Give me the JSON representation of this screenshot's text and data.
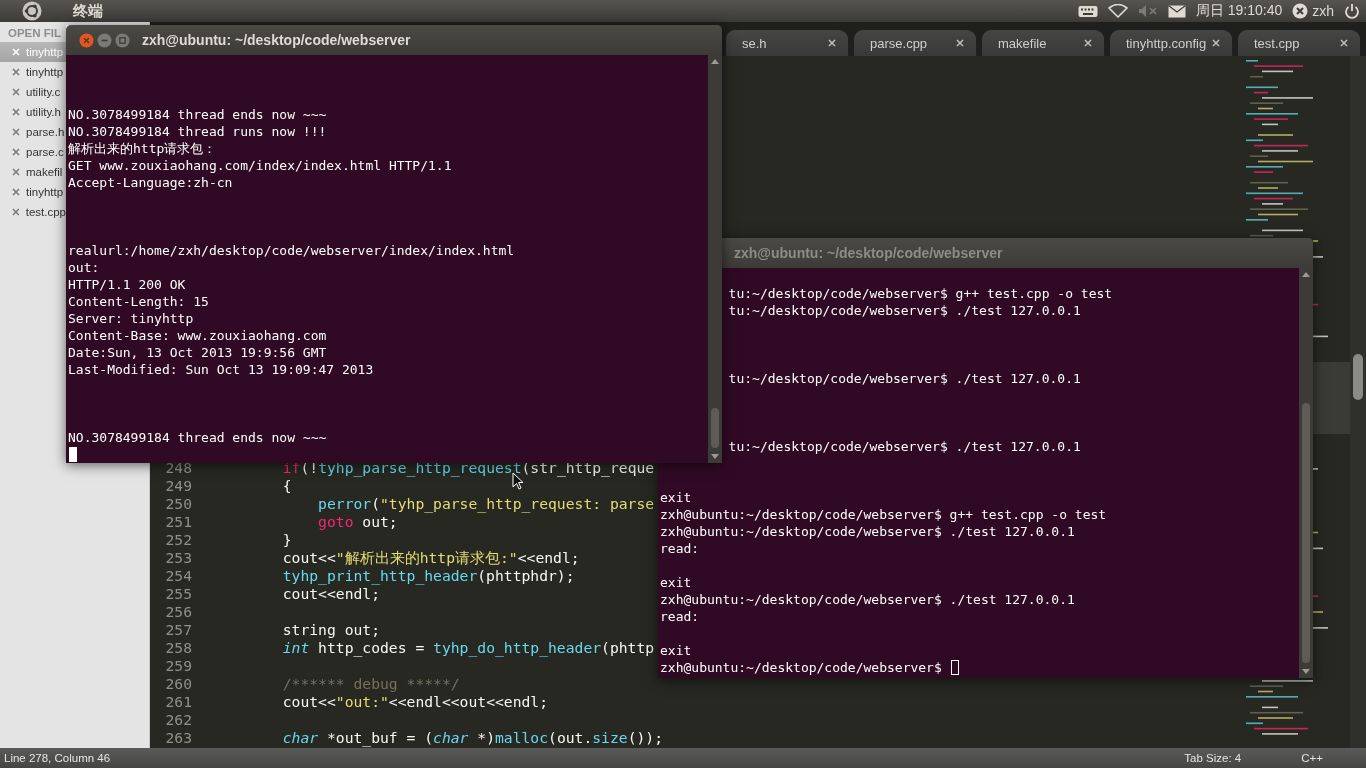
{
  "top_panel": {
    "app_title": "终端",
    "clock": "周日 19:10:40",
    "user": "zxh"
  },
  "sidebar": {
    "header": "OPEN FIL",
    "items": [
      {
        "label": "tinyhttp",
        "selected": true
      },
      {
        "label": "tinyhttp",
        "selected": false
      },
      {
        "label": "utility.c",
        "selected": false
      },
      {
        "label": "utility.h",
        "selected": false
      },
      {
        "label": "parse.h",
        "selected": false
      },
      {
        "label": "parse.c",
        "selected": false
      },
      {
        "label": "makefil",
        "selected": false
      },
      {
        "label": "tinyhttp",
        "selected": false
      },
      {
        "label": "test.cpp",
        "selected": false
      }
    ]
  },
  "tabs": [
    {
      "label": "se.h",
      "selected": false
    },
    {
      "label": "parse.cpp",
      "selected": false
    },
    {
      "label": "makefile",
      "selected": false
    },
    {
      "label": "tinyhttp.config",
      "selected": false
    },
    {
      "label": "test.cpp",
      "selected": false
    }
  ],
  "code_lines": [
    {
      "number": "248",
      "tokens": [
        {
          "kind": "keyword",
          "text": "        if"
        },
        {
          "kind": "plain",
          "text": "(!"
        },
        {
          "kind": "function",
          "text": "tyhp_parse_http_request"
        },
        {
          "kind": "plain",
          "text": "(str_http_reque"
        }
      ]
    },
    {
      "number": "249",
      "tokens": [
        {
          "kind": "plain",
          "text": "        {"
        }
      ]
    },
    {
      "number": "250",
      "tokens": [
        {
          "kind": "function",
          "text": "            perror"
        },
        {
          "kind": "plain",
          "text": "("
        },
        {
          "kind": "string",
          "text": "\"tyhp_parse_http_request: parse"
        }
      ]
    },
    {
      "number": "251",
      "tokens": [
        {
          "kind": "keyword",
          "text": "            goto"
        },
        {
          "kind": "plain",
          "text": " out;"
        }
      ]
    },
    {
      "number": "252",
      "tokens": [
        {
          "kind": "plain",
          "text": "        }"
        }
      ]
    },
    {
      "number": "253",
      "tokens": [
        {
          "kind": "plain",
          "text": "        cout<<"
        },
        {
          "kind": "string",
          "text": "\"解析出来的http请求包:\""
        },
        {
          "kind": "plain",
          "text": "<<endl;"
        }
      ]
    },
    {
      "number": "254",
      "tokens": [
        {
          "kind": "function",
          "text": "        tyhp_print_http_header"
        },
        {
          "kind": "plain",
          "text": "(phttphdr);"
        }
      ]
    },
    {
      "number": "255",
      "tokens": [
        {
          "kind": "plain",
          "text": "        cout<<endl;"
        }
      ]
    },
    {
      "number": "256"
    },
    {
      "number": "257",
      "tokens": [
        {
          "kind": "plain",
          "text": "        string out;"
        }
      ]
    },
    {
      "number": "258",
      "tokens": [
        {
          "kind": "type",
          "text": "        int"
        },
        {
          "kind": "plain",
          "text": " http_codes = "
        },
        {
          "kind": "function",
          "text": "tyhp_do_http_header"
        },
        {
          "kind": "plain",
          "text": "(phttp"
        }
      ]
    },
    {
      "number": "259"
    },
    {
      "number": "260",
      "tokens": [
        {
          "kind": "comment",
          "text": "        /****** debug *****/"
        }
      ]
    },
    {
      "number": "261",
      "tokens": [
        {
          "kind": "plain",
          "text": "        cout<<"
        },
        {
          "kind": "string",
          "text": "\"out:\""
        },
        {
          "kind": "plain",
          "text": "<<endl<<out<<endl;"
        }
      ]
    },
    {
      "number": "262"
    },
    {
      "number": "263",
      "tokens": [
        {
          "kind": "type",
          "text": "        char"
        },
        {
          "kind": "plain",
          "text": " *out_buf = ("
        },
        {
          "kind": "type",
          "text": "char"
        },
        {
          "kind": "plain",
          "text": " *)"
        },
        {
          "kind": "function",
          "text": "malloc"
        },
        {
          "kind": "plain",
          "text": "(out."
        },
        {
          "kind": "function",
          "text": "size"
        },
        {
          "kind": "plain",
          "text": "());"
        }
      ]
    }
  ],
  "status_bar": {
    "position": "Line 278, Column 46",
    "tab_size": "Tab Size: 4",
    "syntax": "C++"
  },
  "terminals": [
    {
      "title": "zxh@ubuntu: ~/desktop/code/webserver",
      "focused": true,
      "lines": [
        {
          "kind": "blank"
        },
        {
          "kind": "blank"
        },
        {
          "kind": "blank"
        },
        {
          "kind": "text",
          "text": "NO.3078499184 thread ends now ~~~"
        },
        {
          "kind": "text",
          "text": "NO.3078499184 thread runs now !!!"
        },
        {
          "kind": "text",
          "text": "解析出来的http请求包："
        },
        {
          "kind": "text",
          "text": "GET www.zouxiaohang.com/index/index.html HTTP/1.1"
        },
        {
          "kind": "text",
          "text": "Accept-Language:zh-cn"
        },
        {
          "kind": "blank"
        },
        {
          "kind": "blank"
        },
        {
          "kind": "blank"
        },
        {
          "kind": "text",
          "text": "realurl:/home/zxh/desktop/code/webserver/index/index.html"
        },
        {
          "kind": "text",
          "text": "out:"
        },
        {
          "kind": "text",
          "text": "HTTP/1.1 200 OK"
        },
        {
          "kind": "text",
          "text": "Content-Length: 15"
        },
        {
          "kind": "text",
          "text": "Server: tinyhttp"
        },
        {
          "kind": "text",
          "text": "Content-Base: www.zouxiaohang.com"
        },
        {
          "kind": "text",
          "text": "Date:Sun, 13 Oct 2013 19:9:56 GMT"
        },
        {
          "kind": "text",
          "text": "Last-Modified: Sun Oct 13 19:09:47 2013"
        },
        {
          "kind": "blank"
        },
        {
          "kind": "blank"
        },
        {
          "kind": "blank"
        },
        {
          "kind": "text",
          "text": "NO.3078499184 thread ends now ~~~"
        },
        {
          "kind": "blank"
        }
      ]
    },
    {
      "title": "zxh@ubuntu: ~/desktop/code/webserver",
      "focused": false,
      "lines": [
        {
          "kind": "blank"
        },
        {
          "kind": "cut",
          "text": "tu:~/desktop/code/webserver$ g++ test.cpp -o test"
        },
        {
          "kind": "cut",
          "text": "tu:~/desktop/code/webserver$ ./test 127.0.0.1"
        },
        {
          "kind": "blank"
        },
        {
          "kind": "blank"
        },
        {
          "kind": "blank"
        },
        {
          "kind": "cut",
          "text": "tu:~/desktop/code/webserver$ ./test 127.0.0.1"
        },
        {
          "kind": "blank"
        },
        {
          "kind": "blank"
        },
        {
          "kind": "blank"
        },
        {
          "kind": "cut",
          "text": "tu:~/desktop/code/webserver$ ./test 127.0.0.1"
        },
        {
          "kind": "blank"
        },
        {
          "kind": "blank"
        },
        {
          "kind": "text",
          "text": "exit"
        },
        {
          "kind": "text",
          "text": "zxh@ubuntu:~/desktop/code/webserver$ g++ test.cpp -o test"
        },
        {
          "kind": "text",
          "text": "zxh@ubuntu:~/desktop/code/webserver$ ./test 127.0.0.1"
        },
        {
          "kind": "text",
          "text": "read:"
        },
        {
          "kind": "blank"
        },
        {
          "kind": "text",
          "text": "exit"
        },
        {
          "kind": "text",
          "text": "zxh@ubuntu:~/desktop/code/webserver$ ./test 127.0.0.1"
        },
        {
          "kind": "text",
          "text": "read:"
        },
        {
          "kind": "blank"
        },
        {
          "kind": "text",
          "text": "exit"
        },
        {
          "kind": "text",
          "text": "zxh@ubuntu:~/desktop/code/webserver$ "
        }
      ]
    }
  ]
}
